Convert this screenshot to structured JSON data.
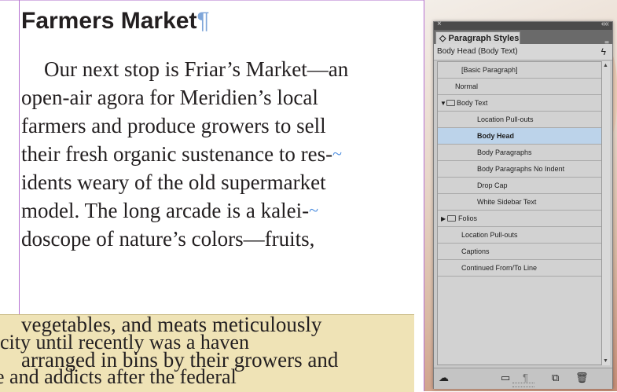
{
  "document": {
    "title": "Farmers Market",
    "pilcrow": "¶",
    "body_lines": [
      "Our next stop is Friar’s Market—an",
      "open-air agora for Meridien’s local",
      "farmers and produce growers to sell",
      "their fresh organic sustenance to res-",
      "idents weary of the old supermarket",
      "model. The long arcade is a kalei-",
      "doscope of nature’s colors—fruits,"
    ],
    "overlap_lines": [
      "vegetables, and meats meticulously",
      "city until recently was a haven",
      "arranged in bins by their growers and",
      "e and addicts after the federal"
    ],
    "hyphen_marker": "~"
  },
  "panel": {
    "close_glyph": "×",
    "collapse_glyph": "««",
    "tab_label": "◇ Paragraph Styles",
    "menu_glyph": "≡",
    "current_style": "Body Head (Body Text)",
    "lightning_glyph": "ϟ",
    "styles": [
      {
        "label": "[Basic Paragraph]",
        "level": 1
      },
      {
        "label": "Normal",
        "level": 1
      },
      {
        "label": "Body Text",
        "level": 0,
        "folder": true,
        "expanded": true
      },
      {
        "label": "Location Pull-outs",
        "level": 2
      },
      {
        "label": "Body Head",
        "level": 2,
        "selected": true
      },
      {
        "label": "Body Paragraphs",
        "level": 2
      },
      {
        "label": "Body Paragraphs No Indent",
        "level": 2
      },
      {
        "label": "Drop Cap",
        "level": 2
      },
      {
        "label": "White Sidebar Text",
        "level": 2
      },
      {
        "label": "Folios",
        "level": 0,
        "folder": true,
        "expanded": false
      },
      {
        "label": "Location Pull-outs",
        "level": 1
      },
      {
        "label": "Captions",
        "level": 1
      },
      {
        "label": "Continued From/To Line",
        "level": 1
      }
    ],
    "bottom_icons": [
      "cloud-icon",
      "new-group-icon",
      "clear-overrides-icon",
      "new-style-icon",
      "trash-icon"
    ]
  }
}
